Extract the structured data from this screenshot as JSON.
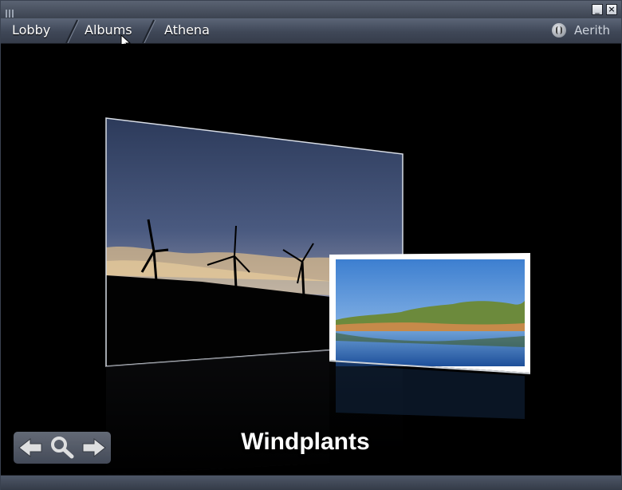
{
  "nav": {
    "tabs": [
      {
        "label": "Lobby"
      },
      {
        "label": "Albums"
      },
      {
        "label": "Athena"
      }
    ],
    "user": "Aerith"
  },
  "window": {
    "minimize_label": "_",
    "close_label": "×"
  },
  "viewer": {
    "caption": "Windplants",
    "photos": [
      {
        "subject": "wind turbines silhouetted at sunset"
      },
      {
        "subject": "lake reflecting green hills"
      }
    ]
  },
  "controls": {
    "prev_icon": "arrow-left-icon",
    "zoom_icon": "magnifier-icon",
    "next_icon": "arrow-right-icon"
  },
  "colors": {
    "chrome": "#3f4757",
    "accent_text": "#ffffff"
  }
}
